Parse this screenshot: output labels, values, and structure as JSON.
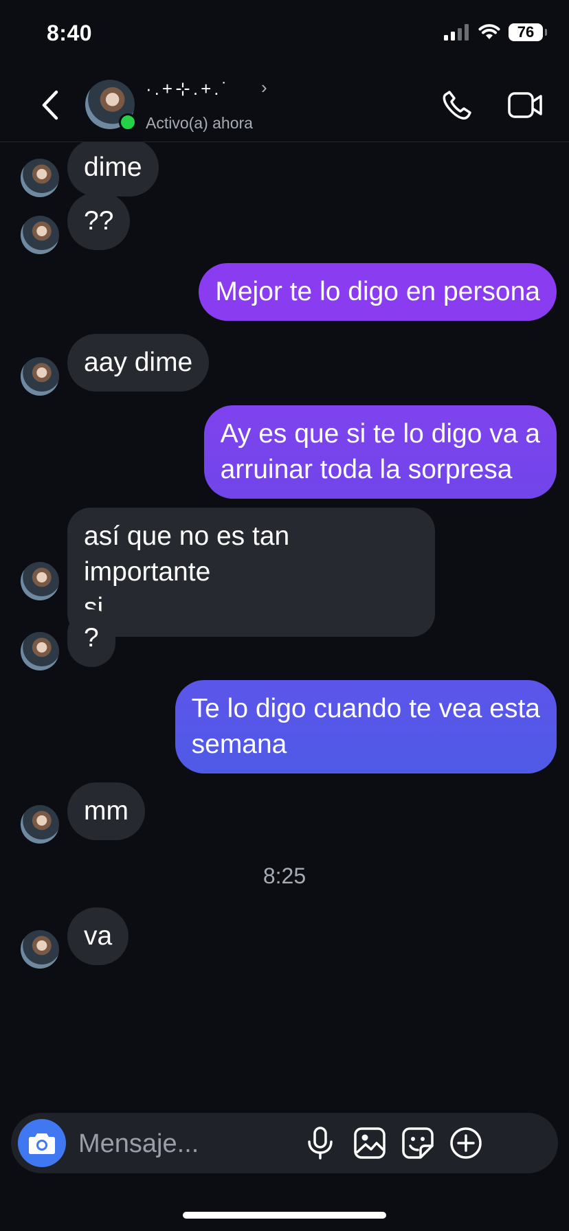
{
  "status_bar": {
    "time": "8:40",
    "battery": "76"
  },
  "header": {
    "contact_name": "·.+⊹.+.˙",
    "chevron": "›",
    "status": "Activo(a) ahora"
  },
  "colors": {
    "background": "#0b0d12",
    "incoming_bubble": "#262930",
    "outgoing_top": "#8a3df0",
    "outgoing_bottom": "#4f5ae6",
    "online": "#26d047",
    "camera": "#3f78f1"
  },
  "messages": [
    {
      "dir": "in",
      "text": "dime"
    },
    {
      "dir": "in",
      "text": "??"
    },
    {
      "dir": "out",
      "text": "Mejor te lo digo en persona"
    },
    {
      "dir": "in",
      "text": "aay dime"
    },
    {
      "dir": "out",
      "text": "Ay es que si te lo digo va a\narruinar toda la sorpresa"
    },
    {
      "dir": "in",
      "text": "así que no es tan importante\nsi"
    },
    {
      "dir": "in",
      "text": "?"
    },
    {
      "dir": "out",
      "text": "Te lo digo cuando te vea esta\nsemana"
    },
    {
      "dir": "in",
      "text": "mm"
    },
    {
      "dir": "in",
      "text": "va"
    }
  ],
  "timestamp": "8:25",
  "composer": {
    "placeholder": "Mensaje..."
  }
}
